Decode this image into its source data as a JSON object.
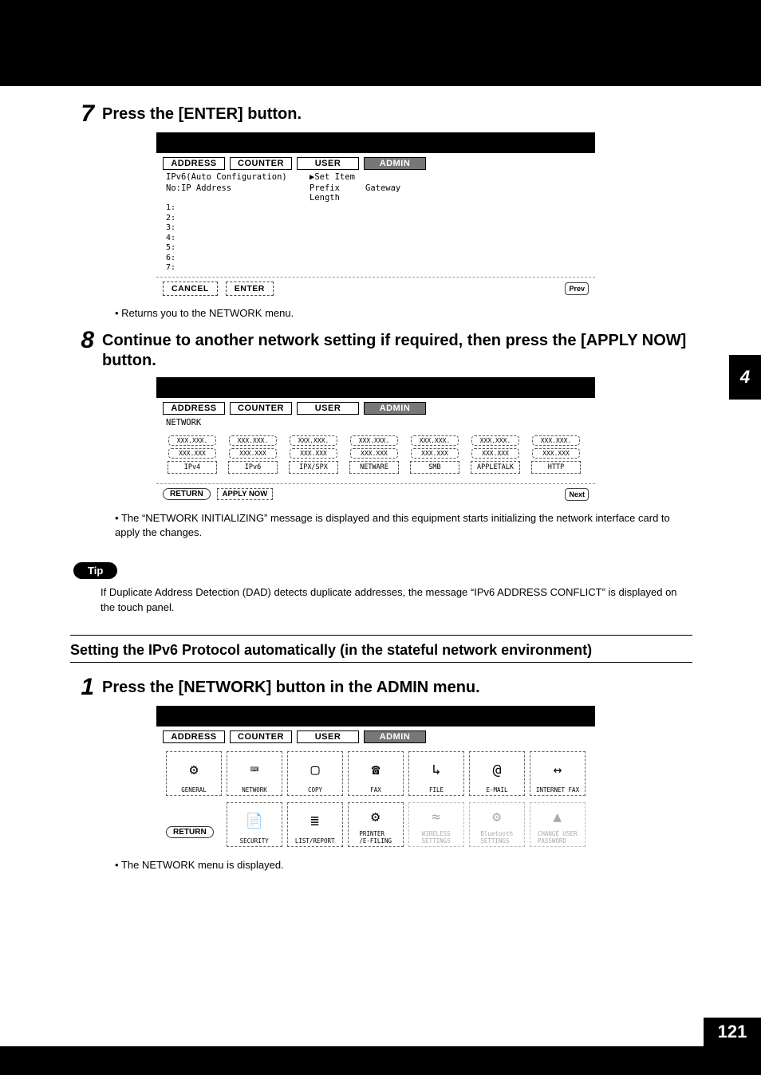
{
  "side_tab": "4",
  "page_number": "121",
  "steps": {
    "s7": {
      "num": "7",
      "title": "Press the [ENTER] button.",
      "note": "Returns you to the NETWORK menu."
    },
    "s8": {
      "num": "8",
      "title": "Continue to another network setting if required, then press the [APPLY NOW] button.",
      "note": "The “NETWORK INITIALIZING” message is displayed and this equipment starts initializing the network interface card to apply the changes."
    },
    "s1": {
      "num": "1",
      "title": "Press the [NETWORK] button in the ADMIN menu.",
      "note": "The NETWORK menu is displayed."
    }
  },
  "tip": {
    "badge": "Tip",
    "text": "If Duplicate Address Detection (DAD) detects duplicate addresses, the message “IPv6 ADDRESS CONFLICT” is displayed on the touch panel."
  },
  "section": {
    "title": "Setting the IPv6 Protocol automatically (in the stateful network environment)"
  },
  "tabs": {
    "address": "ADDRESS",
    "counter": "COUNTER",
    "user": "USER",
    "admin": "ADMIN"
  },
  "screen1": {
    "heading": "IPv6(Auto Configuration)",
    "set_item": "▶Set Item",
    "col_no": "No:IP Address",
    "col_prefix": "Prefix\nLength",
    "col_gateway": "Gateway",
    "rows": [
      "1:",
      "2:",
      "3:",
      "4:",
      "5:",
      "6:",
      "7:"
    ],
    "cancel": "CANCEL",
    "enter": "ENTER",
    "prev": "Prev"
  },
  "screen2": {
    "heading": "NETWORK",
    "pill_top": "XXX.XXX.",
    "pill_bot": "XXX.XXX",
    "cells": [
      "IPv4",
      "IPv6",
      "IPX/SPX",
      "NETWARE",
      "SMB",
      "APPLETALK",
      "HTTP"
    ],
    "return": "RETURN",
    "apply": "APPLY NOW",
    "next": "Next"
  },
  "screen3": {
    "cells_row1": [
      "GENERAL",
      "NETWORK",
      "COPY",
      "FAX",
      "FILE",
      "E-MAIL",
      "INTERNET FAX"
    ],
    "cells_row2": [
      "SECURITY",
      "LIST/REPORT",
      "PRINTER\n/E-FILING",
      "WIRELESS\nSETTINGS",
      "Bluetooth\nSETTINGS",
      "CHANGE USER\nPASSWORD"
    ],
    "return": "RETURN",
    "icons_row1": [
      "⚙",
      "⌨",
      "▢",
      "☎",
      "↳",
      "@",
      "↔"
    ],
    "icons_row2": [
      "📄",
      "≣",
      "⚙",
      "≈",
      "⚙",
      "▲"
    ]
  }
}
